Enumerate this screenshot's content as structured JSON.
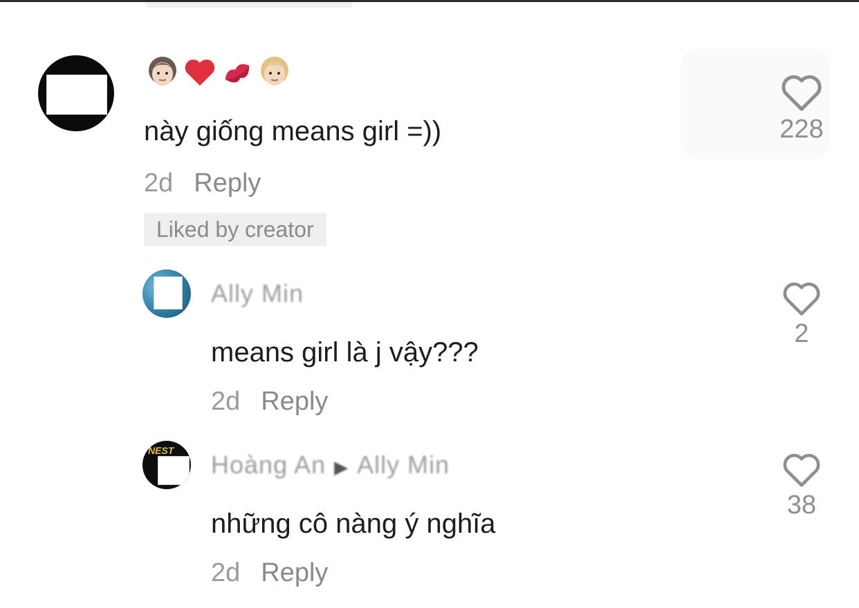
{
  "main_comment": {
    "username_emoji": [
      "woman",
      "heart",
      "lips",
      "woman-blonde"
    ],
    "text": "này giống means girl =))",
    "time": "2d",
    "reply_label": "Reply",
    "badge": "Liked by creator",
    "likes": "228"
  },
  "replies": [
    {
      "username": "Ally Min",
      "text": "means girl là j vậy???",
      "time": "2d",
      "reply_label": "Reply",
      "likes": "2"
    },
    {
      "username": "Hoàng An",
      "reply_to": "Ally Min",
      "avatar_tag": "NEST",
      "text": "những cô nàng ý nghĩa",
      "time": "2d",
      "reply_label": "Reply",
      "likes": "38"
    }
  ]
}
